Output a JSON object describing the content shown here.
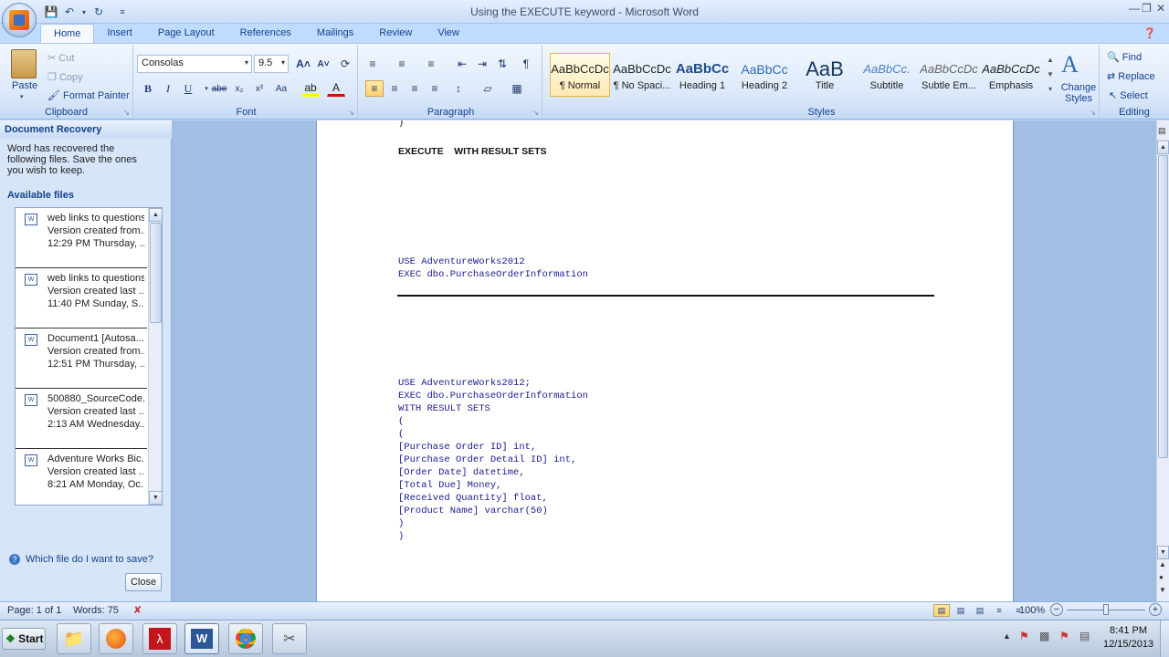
{
  "window": {
    "title": "Using the EXECUTE keyword - Microsoft Word"
  },
  "tabs": [
    "Home",
    "Insert",
    "Page Layout",
    "References",
    "Mailings",
    "Review",
    "View"
  ],
  "ribbon": {
    "clipboard": {
      "label": "Clipboard",
      "paste": "Paste",
      "cut": "Cut",
      "copy": "Copy",
      "format_painter": "Format Painter"
    },
    "font": {
      "label": "Font",
      "family": "Consolas",
      "size": "9.5"
    },
    "paragraph": {
      "label": "Paragraph"
    },
    "styles": {
      "label": "Styles",
      "items": [
        {
          "preview": "AaBbCcDc",
          "name": "¶ Normal"
        },
        {
          "preview": "AaBbCcDc",
          "name": "¶ No Spaci..."
        },
        {
          "preview": "AaBbCc",
          "name": "Heading 1"
        },
        {
          "preview": "AaBbCc",
          "name": "Heading 2"
        },
        {
          "preview": "AaB",
          "name": "Title"
        },
        {
          "preview": "AaBbCc.",
          "name": "Subtitle"
        },
        {
          "preview": "AaBbCcDc",
          "name": "Subtle Em..."
        },
        {
          "preview": "AaBbCcDc",
          "name": "Emphasis"
        }
      ],
      "change_styles": "Change Styles"
    },
    "editing": {
      "label": "Editing",
      "find": "Find",
      "replace": "Replace",
      "select": "Select"
    }
  },
  "recovery": {
    "title": "Document Recovery",
    "message": "Word has recovered the following files.  Save the ones you wish to keep.",
    "available_label": "Available files",
    "files": [
      {
        "name": "web links to questions ...",
        "status": "Version created from...",
        "time": "12:29 PM Thursday, ..."
      },
      {
        "name": "web links to questions ...",
        "status": "Version created last ...",
        "time": "11:40 PM Sunday, S..."
      },
      {
        "name": "Document1  [Autosa...",
        "status": "Version created from...",
        "time": "12:51 PM Thursday, ..."
      },
      {
        "name": "500880_SourceCode...",
        "status": "Version created last ...",
        "time": "2:13 AM Wednesday..."
      },
      {
        "name": "Adventure Works Bic...",
        "status": "Version created last ...",
        "time": "8:21 AM Monday, Oc..."
      }
    ],
    "help_link": "Which file do I want to save?",
    "close": "Close"
  },
  "document": {
    "top_paren": ")",
    "heading": "EXECUTE    WITH RESULT SETS",
    "block1": [
      "USE AdventureWorks2012",
      "EXEC dbo.PurchaseOrderInformation"
    ],
    "block2": [
      "USE AdventureWorks2012;",
      "EXEC dbo.PurchaseOrderInformation",
      "WITH RESULT SETS",
      "(",
      "(",
      "[Purchase Order ID] int,",
      "[Purchase Order Detail ID] int,",
      "[Order Date] datetime,",
      "[Total Due] Money,",
      "[Received Quantity] float,",
      "[Product Name] varchar(50)",
      ")",
      ")"
    ]
  },
  "status": {
    "page": "Page: 1 of 1",
    "words": "Words: 75",
    "zoom": "100%"
  },
  "taskbar": {
    "start": "Start",
    "time": "8:41 PM",
    "date": "12/15/2013"
  },
  "colors": {
    "accent": "#15428b",
    "code_blue": "#1a1a8e",
    "doc_bg": "#a3bee3"
  }
}
